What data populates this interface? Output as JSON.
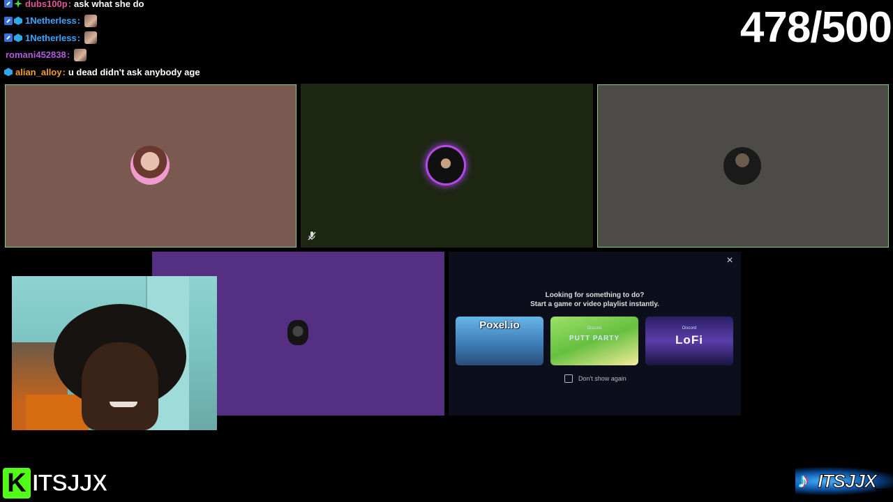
{
  "chat": [
    {
      "badges": [
        "mod",
        "star"
      ],
      "username": "dubs100p",
      "color": "#e0569a",
      "message": "ask what she do",
      "emote": false
    },
    {
      "badges": [
        "mod",
        "gem"
      ],
      "username": "1Netherless",
      "color": "#3aa5ff",
      "message": "",
      "emote": true
    },
    {
      "badges": [
        "mod",
        "gem"
      ],
      "username": "1Netherless",
      "color": "#3aa5ff",
      "message": "",
      "emote": true
    },
    {
      "badges": [],
      "username": "romani452838",
      "color": "#b15bd8",
      "message": "",
      "emote": true
    },
    {
      "badges": [
        "gem"
      ],
      "username": "alian_alloy",
      "color": "#f0a030",
      "message": "u dead didn't ask anybody age",
      "emote": false
    }
  ],
  "counter": "478/500",
  "popup": {
    "title_line1": "Looking for something to do?",
    "title_line2": "Start a game or video playlist instantly.",
    "close_icon": "×",
    "cards": [
      {
        "label": "Poxel.io",
        "sub": ""
      },
      {
        "label": "PUTT PARTY",
        "sub": "Discord"
      },
      {
        "label": "LoFi",
        "sub": "Discord"
      }
    ],
    "checkbox_label": "Don't show again"
  },
  "kick": {
    "letter": "K",
    "name": "ITSJJX"
  },
  "tiktok": {
    "icon": "♪",
    "name": "ITSJJX__"
  },
  "colors": {
    "speaking_border": "#7dd27a",
    "kick_green": "#53fc18",
    "popup_bg": "#0d0e1b"
  }
}
